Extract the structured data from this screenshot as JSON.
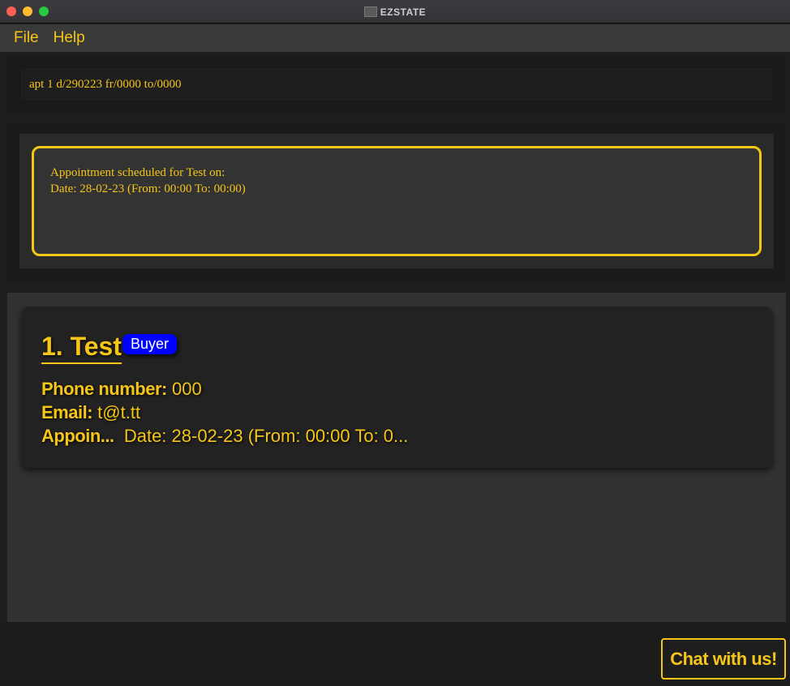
{
  "window": {
    "title": "EZSTATE",
    "controls": [
      "close",
      "minimize",
      "maximize"
    ]
  },
  "menu": {
    "file": "File",
    "help": "Help"
  },
  "command_box": {
    "value": "apt 1 d/290223 fr/0000 to/0000"
  },
  "result": {
    "line1": "Appointment scheduled for Test on:",
    "line2": "Date: 28-02-23 (From: 00:00 To: 00:00)"
  },
  "persons": [
    {
      "name": "1. Test",
      "tag": "Buyer",
      "phone_label": "Phone number:",
      "phone": "000",
      "email_label": "Email:",
      "email": "t@t.tt",
      "appointment_label": "Appoin...",
      "appointment": "Date: 28-02-23 (From: 00:00 To: 0..."
    }
  ],
  "chat_button": {
    "label": "Chat with us!"
  },
  "colors": {
    "accent": "#f5c518",
    "tag_buyer": "#0000ff",
    "background": "#1e1e1e"
  }
}
